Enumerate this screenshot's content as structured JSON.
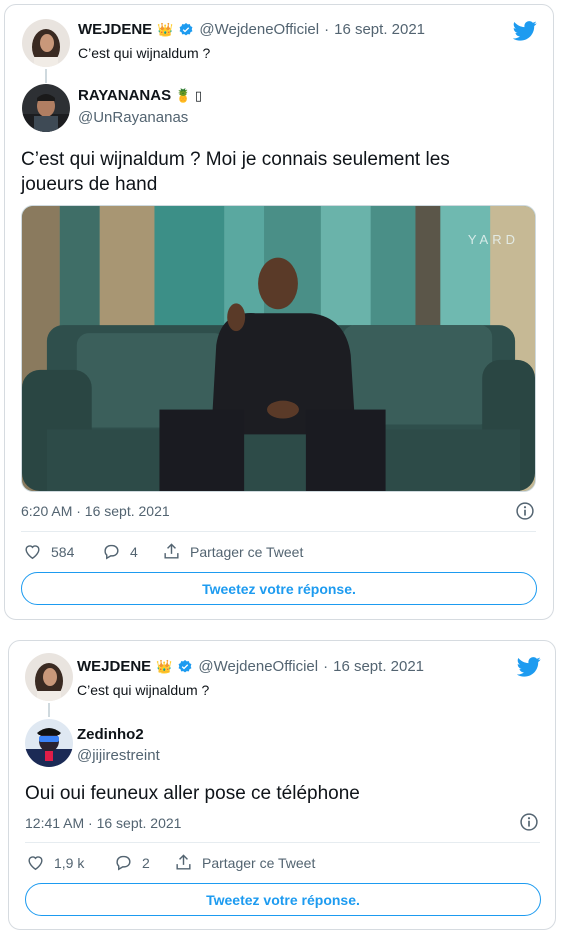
{
  "colors": {
    "twitter_blue": "#1d9bf0",
    "verified_blue": "#1d9bf0",
    "text_gray": "#536471"
  },
  "tweet1": {
    "quoted": {
      "display_name": "WEJDENE",
      "handle": "@WejdeneOfficiel",
      "separator": "·",
      "date": "16 sept. 2021",
      "text": "C’est qui wijnaldum ?"
    },
    "author": {
      "display_name": "RAYANANAS",
      "handle": "@UnRayananas",
      "name_suffix": "🍍 ▯"
    },
    "text": "C’est qui wijnaldum ? Moi je connais seulement les joueurs de hand",
    "media": {
      "watermark": "YARD"
    },
    "timestamp": "6:20 AM · 16 sept. 2021",
    "actions": {
      "likes": "584",
      "replies": "4",
      "share_label": "Partager ce Tweet"
    },
    "reply_button": "Tweetez votre réponse."
  },
  "tweet2": {
    "quoted": {
      "display_name": "WEJDENE",
      "handle": "@WejdeneOfficiel",
      "separator": "·",
      "date": "16 sept. 2021",
      "text": "C’est qui wijnaldum ?"
    },
    "author": {
      "display_name": "Zedinho2",
      "handle": "@jijirestreint"
    },
    "text": "Oui oui feuneux aller pose ce téléphone",
    "timestamp": "12:41 AM · 16 sept. 2021",
    "actions": {
      "likes": "1,9 k",
      "replies": "2",
      "share_label": "Partager ce Tweet"
    },
    "reply_button": "Tweetez votre réponse."
  },
  "icons": [
    "crown-emoji-icon",
    "verified-badge-icon",
    "twitter-bird-icon",
    "info-icon",
    "heart-icon",
    "reply-bubble-icon",
    "share-icon",
    "pineapple-emoji-icon"
  ]
}
